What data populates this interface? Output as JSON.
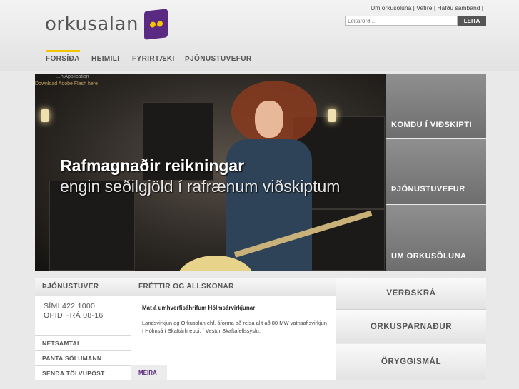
{
  "header": {
    "logo_text": "orkusalan",
    "top_links": [
      "Um orkusöluna",
      "Vefíré",
      "Hafðu samband"
    ],
    "search_placeholder": "Leitarorð ...",
    "search_button": "LEITA"
  },
  "nav": {
    "items": [
      "FORSÍÐA",
      "HEIMILI",
      "FYRIRTÆKI",
      "ÞJÓNUSTUVEFUR"
    ],
    "active_index": 0
  },
  "banner": {
    "flash_line1": "...h Application",
    "flash_line2": "Download Adobe Flash here",
    "title": "Rafmagnaðir reikningar",
    "subtitle": "engin seðilgjöld í rafrænum viðskiptum"
  },
  "side_buttons": [
    "KOMDU Í VIÐSKIPTI",
    "ÞJÓNUSTUVEFUR",
    "UM ORKUSÖLUNA"
  ],
  "service": {
    "heading": "ÞJÓNUSTUVER",
    "phone": "SÍMI 422 1000",
    "hours": "OPIÐ FRÁ 08-16",
    "links": [
      "NETSAMTAL",
      "PANTA SÖLUMANN",
      "SENDA TÖLVUPÓST"
    ]
  },
  "news": {
    "heading": "FRÉTTIR OG ALLSKONAR",
    "item_title": "Mat á umhverfisáhrifum Hólmsárvirkjunar",
    "item_body": "Landsvirkjun og Orkusalan ehf. áforma að reisa allt að 80 MW vatnsaflsvirkjun í Hólmsá í Skaftárhreppi, í Vestur Skaftafellssýslu.",
    "more_label": "MEIRA"
  },
  "right_buttons": [
    "VERÐSKRÁ",
    "ORKUSPARNAÐUR",
    "ÖRYGGISMÁL"
  ],
  "colors": {
    "brand_purple": "#5a2a82",
    "brand_yellow": "#f5c400",
    "search_button_bg": "#555555"
  }
}
